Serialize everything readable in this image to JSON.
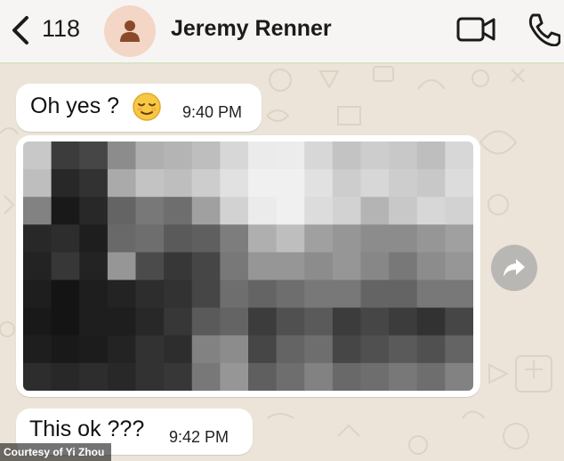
{
  "header": {
    "unread_count": "118",
    "contact_name": "Jeremy Renner",
    "back_icon": "chevron-left-icon",
    "video_icon": "video-camera-icon",
    "call_icon": "phone-icon",
    "avatar_icon": "person-icon"
  },
  "messages": [
    {
      "text": "Oh yes ?",
      "emoji": "relieved-face",
      "time": "9:40 PM"
    },
    {
      "type": "image",
      "content": "pixelated-photo"
    },
    {
      "text": "This ok ???",
      "time": "9:42 PM"
    }
  ],
  "forward_icon": "share-arrow-icon",
  "credit": "Courtesy of Yi Zhou",
  "colors": {
    "header_bg": "#f6f5f3",
    "wallpaper": "#ece4d8",
    "bubble": "#ffffff",
    "avatar_bg": "#f3d6c6"
  }
}
